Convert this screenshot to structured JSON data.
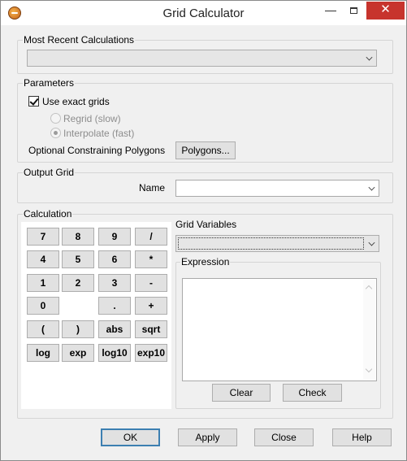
{
  "window": {
    "title": "Grid Calculator",
    "min_glyph": "—",
    "close_glyph": "✕"
  },
  "recent": {
    "group_label": "Most Recent Calculations",
    "value": ""
  },
  "parameters": {
    "group_label": "Parameters",
    "use_exact_grids_label": "Use exact grids",
    "use_exact_grids_checked": true,
    "regrid_label": "Regrid (slow)",
    "interpolate_label": "Interpolate (fast)",
    "constraining_label": "Optional Constraining Polygons",
    "polygons_button": "Polygons..."
  },
  "output": {
    "group_label": "Output Grid",
    "name_label": "Name",
    "name_value": ""
  },
  "calculation": {
    "group_label": "Calculation",
    "keys": [
      [
        "7",
        "8",
        "9",
        "/"
      ],
      [
        "4",
        "5",
        "6",
        "*"
      ],
      [
        "1",
        "2",
        "3",
        "-"
      ],
      [
        "0",
        "",
        ".",
        "+"
      ],
      [
        "(",
        ")",
        "abs",
        "sqrt"
      ],
      [
        "log",
        "exp",
        "log10",
        "exp10"
      ]
    ],
    "grid_variables_label": "Grid Variables",
    "grid_variables_value": "",
    "expression_label": "Expression",
    "expression_value": "",
    "clear_button": "Clear",
    "check_button": "Check"
  },
  "footer": {
    "ok": "OK",
    "apply": "Apply",
    "close": "Close",
    "help": "Help"
  }
}
